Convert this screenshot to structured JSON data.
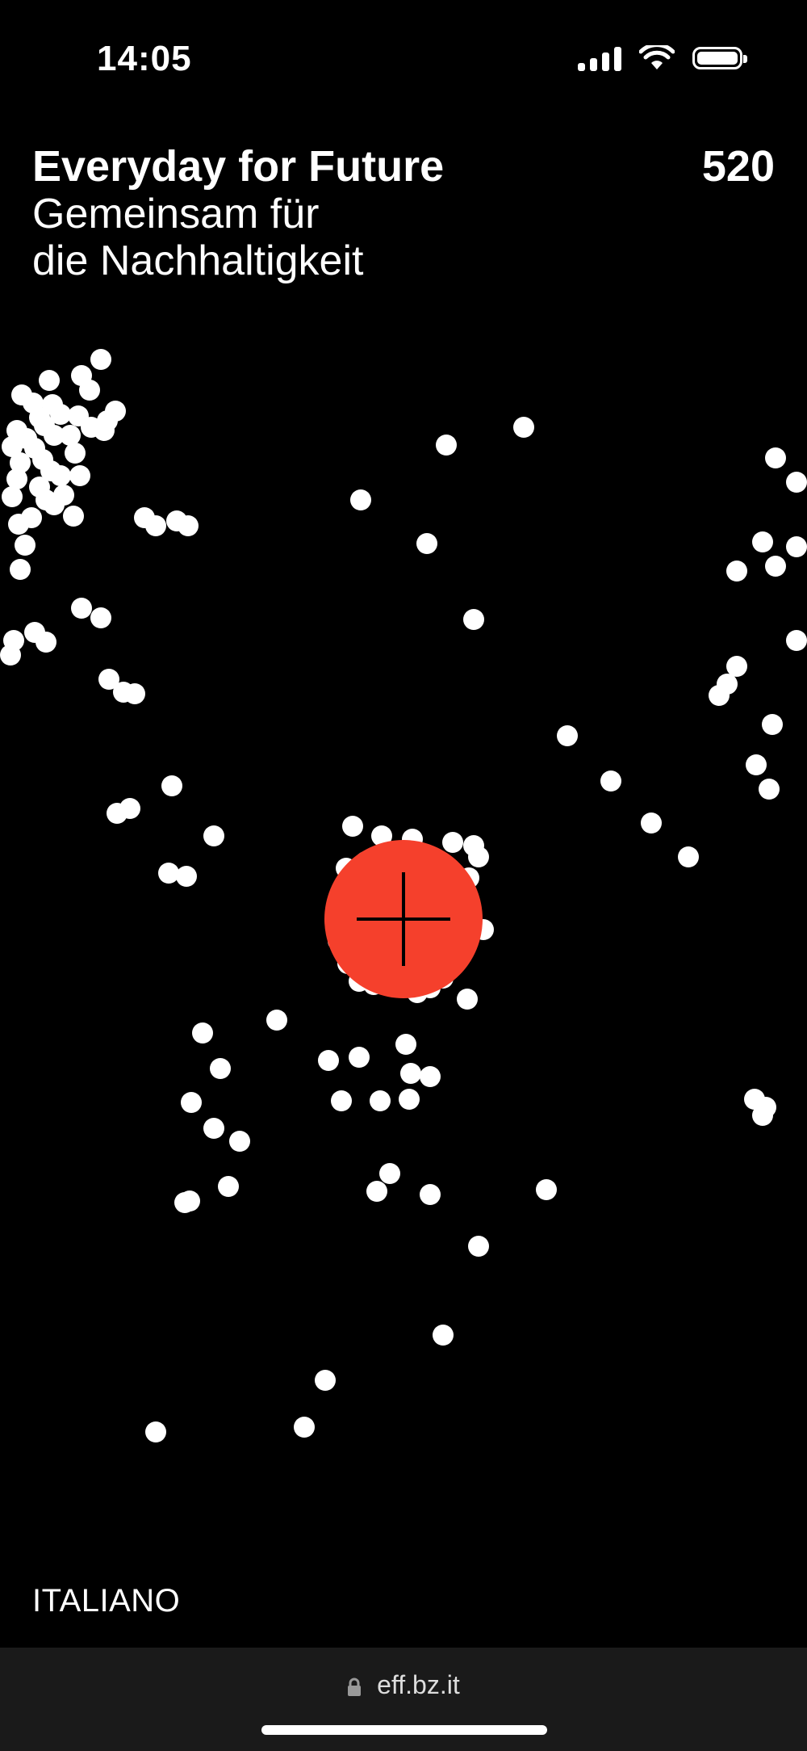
{
  "status_bar": {
    "time": "14:05",
    "icons": [
      "signal-icon",
      "wifi-icon",
      "battery-icon"
    ]
  },
  "header": {
    "title": "Everyday for Future",
    "subtitle_line1": "Gemeinsam für",
    "subtitle_line2": "die Nachhaltigkeit",
    "counter": "520"
  },
  "add_button": {
    "icon": "plus-icon",
    "color": "#f5402c"
  },
  "footer": {
    "language_label": "ITALIANO"
  },
  "browser": {
    "url": "eff.bz.it",
    "icon": "lock-icon"
  },
  "colors": {
    "background": "#000000",
    "dot": "#ffffff",
    "accent": "#f5402c"
  }
}
